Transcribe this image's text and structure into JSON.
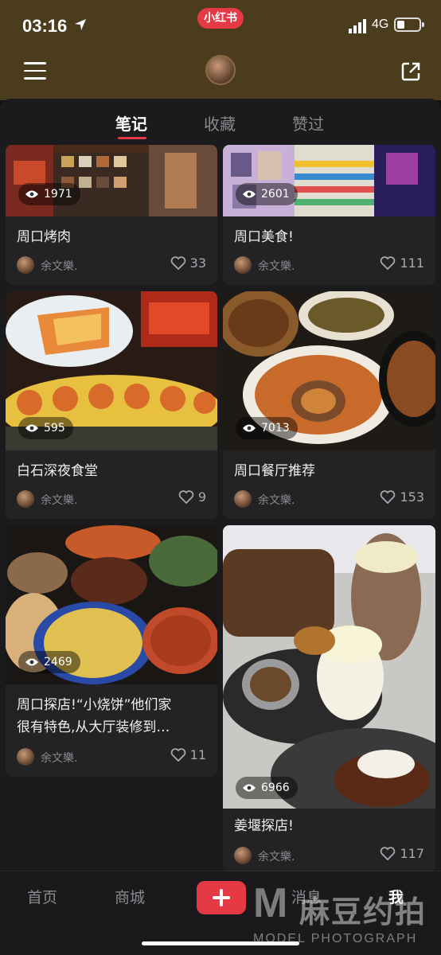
{
  "status": {
    "time": "03:16",
    "network": "4G",
    "battery_level": 0.35
  },
  "app_badge": "小红书",
  "tabs": [
    "笔记",
    "收藏",
    "赞过"
  ],
  "cards": [
    {
      "views": "1971",
      "title": "周口烤肉",
      "author": "余文樂.",
      "likes": "33"
    },
    {
      "views": "2601",
      "title": "周口美食!",
      "author": "余文樂.",
      "likes": "111"
    },
    {
      "views": "595",
      "title": "白石深夜食堂",
      "author": "余文樂.",
      "likes": "9"
    },
    {
      "views": "7013",
      "title": "周口餐厅推荐",
      "author": "余文樂.",
      "likes": "153"
    },
    {
      "views": "2469",
      "title_line1": "周口探店!“小烧饼”他们家",
      "title_line2": "很有特色,从大厅装修到…",
      "author": "余文樂.",
      "likes": "11"
    },
    {
      "views": "6966",
      "title": "姜堰探店!",
      "author": "余文樂.",
      "likes": "117"
    }
  ],
  "nav": {
    "home": "首页",
    "mall": "商城",
    "messages": "消息",
    "me": "我"
  },
  "watermark": {
    "cn": "麻豆约拍",
    "en": "MODEL PHOTOGRAPH"
  },
  "colors": {
    "accent": "#e63946",
    "header_bg": "#4a3c1c"
  }
}
